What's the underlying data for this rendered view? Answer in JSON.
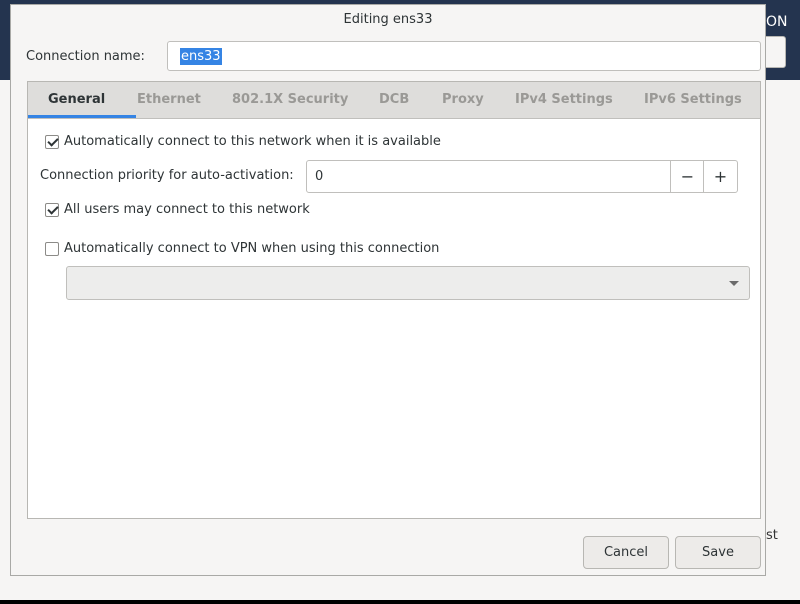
{
  "background": {
    "top_right_text": "ON",
    "side_text": "st"
  },
  "dialog": {
    "title": "Editing ens33",
    "connection_name_label": "Connection name:",
    "connection_name_value": "ens33",
    "tabs": [
      {
        "label": "General",
        "active": true
      },
      {
        "label": "Ethernet"
      },
      {
        "label": "802.1X Security"
      },
      {
        "label": "DCB"
      },
      {
        "label": "Proxy"
      },
      {
        "label": "IPv4 Settings"
      },
      {
        "label": "IPv6 Settings"
      }
    ],
    "general": {
      "auto_connect_label": "Automatically connect to this network when it is available",
      "auto_connect_checked": true,
      "priority_label": "Connection priority for auto-activation:",
      "priority_value": "0",
      "priority_minus": "−",
      "priority_plus": "+",
      "all_users_label": "All users may connect to this network",
      "all_users_checked": true,
      "vpn_label": "Automatically connect to VPN when using this connection",
      "vpn_checked": false,
      "vpn_select_value": ""
    },
    "buttons": {
      "cancel": "Cancel",
      "save": "Save"
    }
  }
}
